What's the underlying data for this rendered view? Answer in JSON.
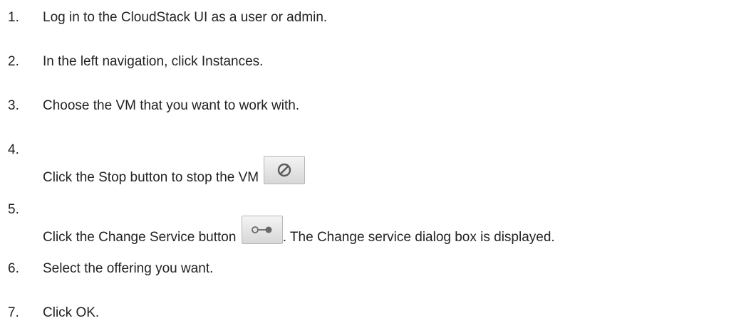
{
  "steps": [
    {
      "number": "1.",
      "text": "Log in to the CloudStack UI as a user or admin."
    },
    {
      "number": "2.",
      "text": "In the left navigation, click Instances."
    },
    {
      "number": "3.",
      "text": "Choose the VM that you want to work with."
    },
    {
      "number": "4.",
      "text": "Click the Stop button to stop the VM",
      "icon": "stop-icon"
    },
    {
      "number": "5.",
      "text": "Click the Change Service button",
      "icon": "change-service-icon",
      "text_after": ". The Change service dialog box is displayed."
    },
    {
      "number": "6.",
      "text": "Select the offering you want."
    },
    {
      "number": "7.",
      "text": "Click OK."
    }
  ]
}
